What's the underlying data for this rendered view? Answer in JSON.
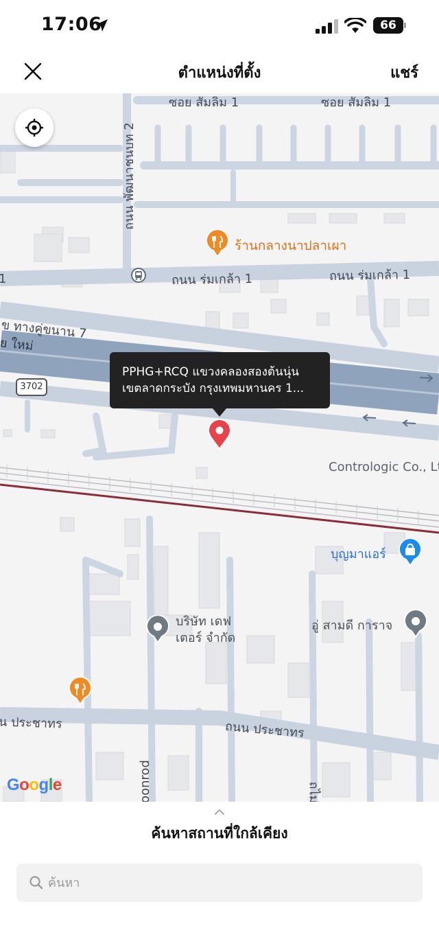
{
  "status_bar": {
    "time": "17:06",
    "battery": "66"
  },
  "nav": {
    "title": "ตำแหน่งที่ตั้ง",
    "share_label": "แชร์"
  },
  "map": {
    "streets": {
      "soi_left": "ซอย สัมลิม 1",
      "soi_right": "ซอย สัมลิม 1",
      "phatthana": "ถนน พัฒนาชนบท 2",
      "romklao_left": "ถนน ร่มเกล้า 1",
      "romklao_right": "ถนน ร่มเกล้า 1",
      "left_edge_1": "1",
      "kukhanan": "ข ทางคู่ขนาน 7",
      "mai": "ย ใหม่",
      "prachathon_left": "น ประชาทร",
      "prachathon_right": "ถนน ประชาทร",
      "onrod": "oonrod",
      "bottom_vertical": "ถไม่"
    },
    "road_shield": "3702",
    "pois": {
      "restaurant": "ร้านกลางนาปลาเผา",
      "contrologic": "Contrologic Co., Ltd",
      "bunma": "บุญมาแอร์",
      "dafter": "บริษัท เดฟ เตอร์ จำกัด",
      "samdee": "อู่ สามดี การาจ"
    },
    "pin_tooltip": {
      "line1": "PPHG+RCQ แขวงคลองสองต้นนุ่น",
      "line2": "เขตลาดกระบัง กรุงเทพมหานคร 1..."
    },
    "logo": [
      "G",
      "o",
      "o",
      "g",
      "l",
      "e"
    ]
  },
  "sheet": {
    "title": "ค้นหาสถานที่ใกล้เคียง",
    "search_placeholder": "ค้นหา"
  },
  "colors": {
    "pin_red": "#e8434b",
    "poi_orange": "#f08a24",
    "poi_blue": "#1a8cf0",
    "poi_gray": "#6f7a85",
    "highway": "#8fa3bd",
    "railway_red": "#8a2c3a"
  }
}
